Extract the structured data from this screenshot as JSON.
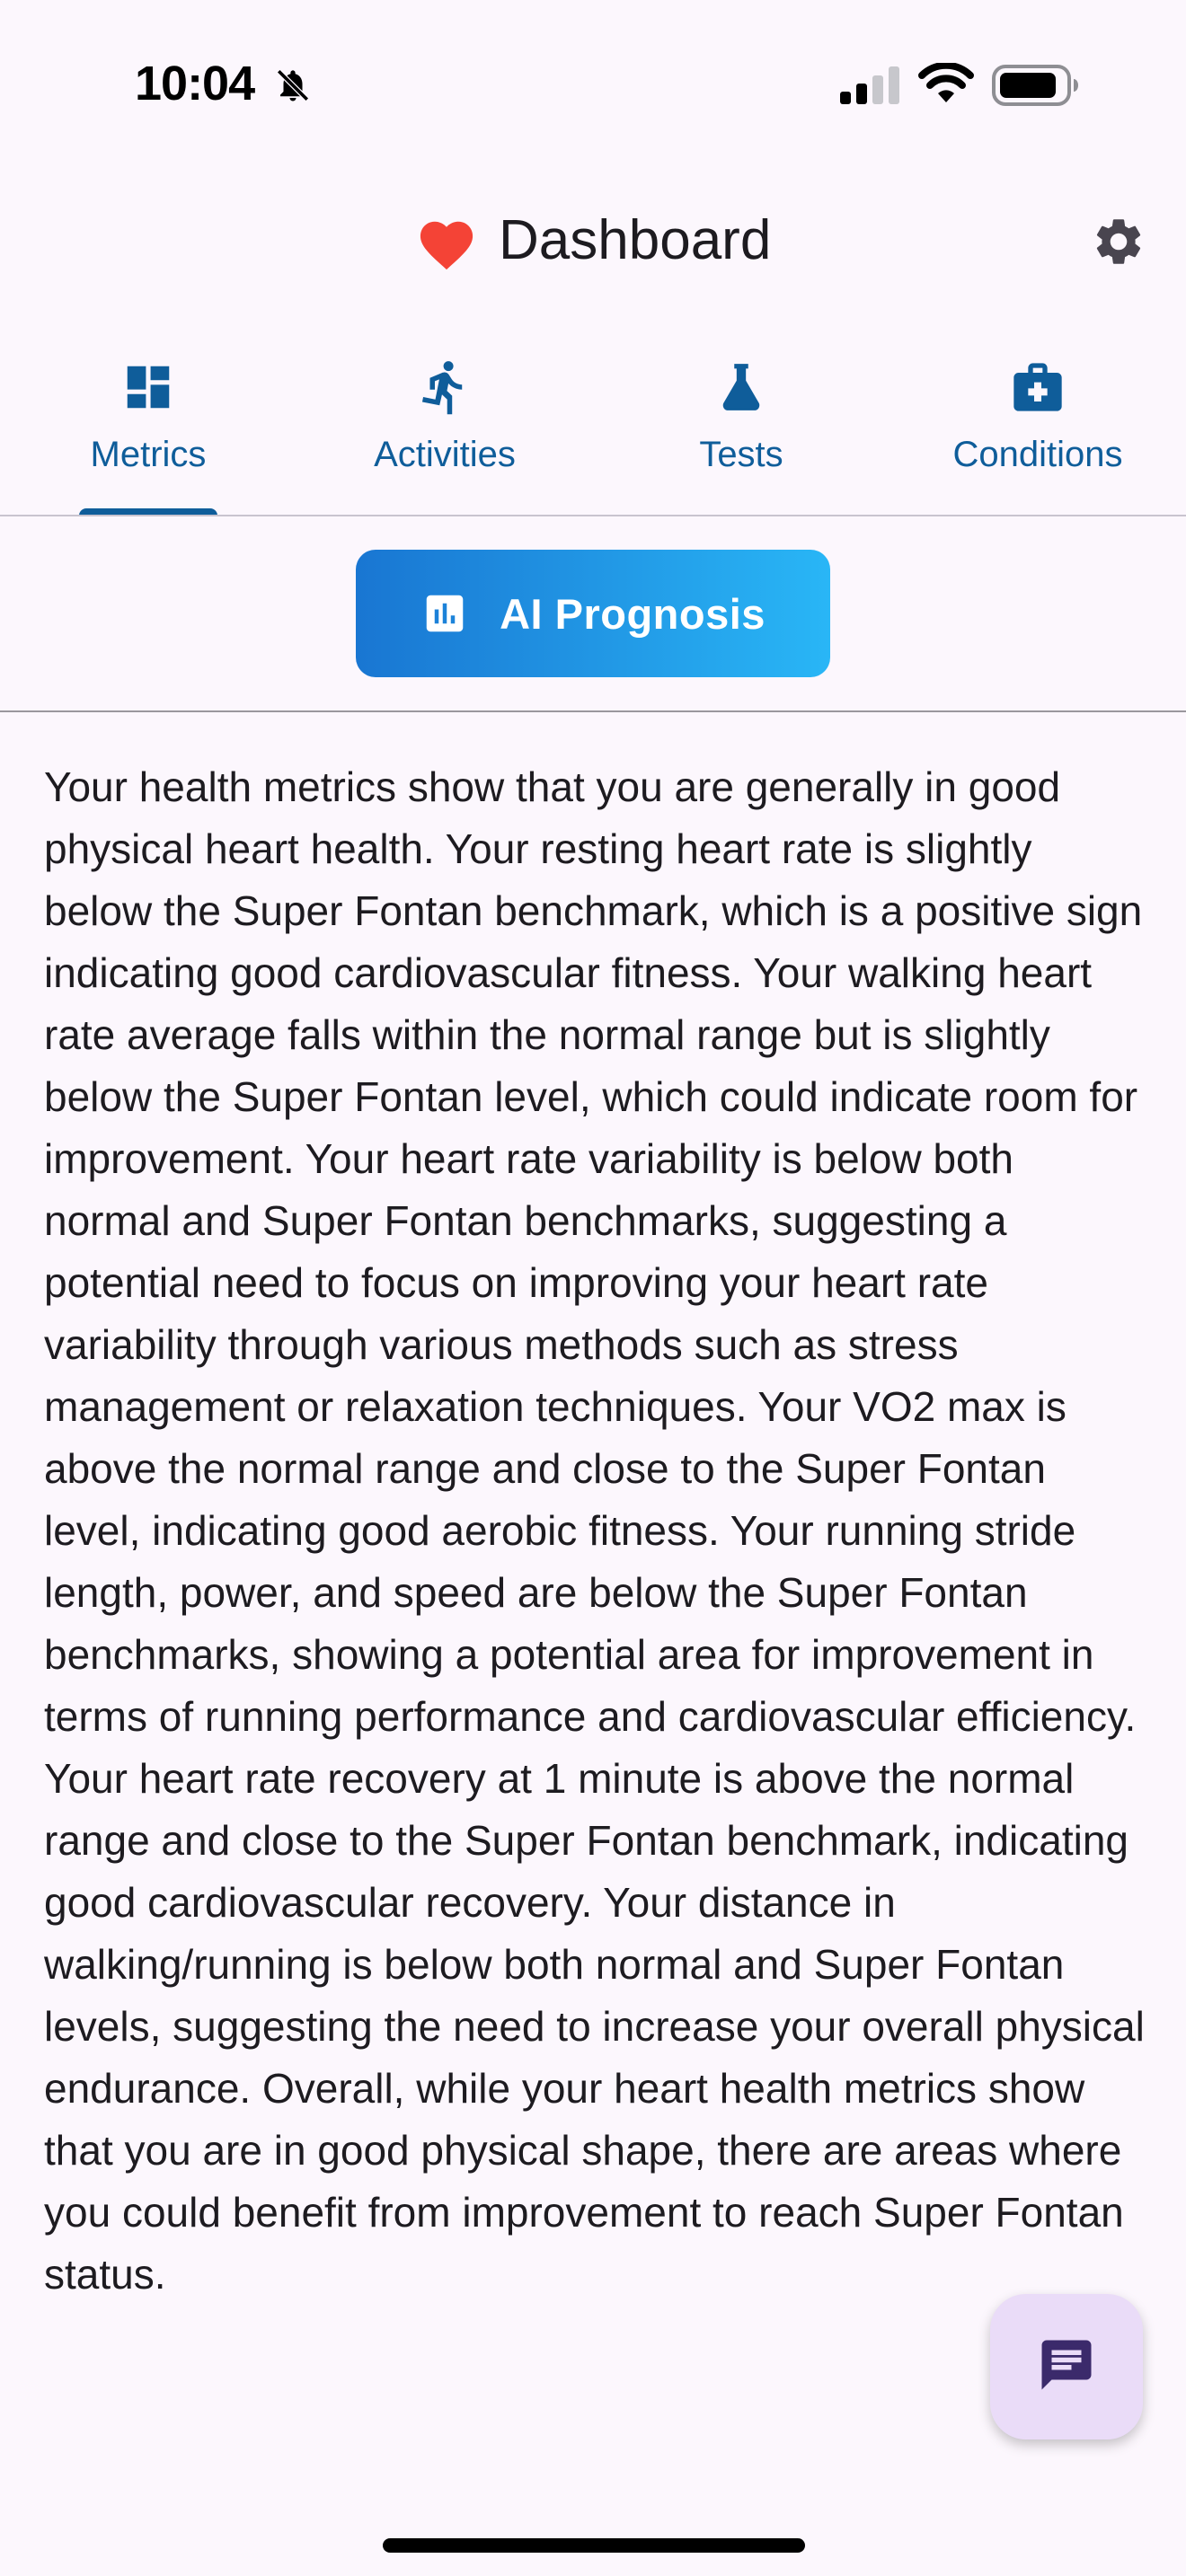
{
  "status_bar": {
    "time": "10:04"
  },
  "header": {
    "title": "Dashboard"
  },
  "tabs": [
    {
      "label": "Metrics",
      "icon": "dashboard-icon",
      "selected": true
    },
    {
      "label": "Activities",
      "icon": "running-icon",
      "selected": false
    },
    {
      "label": "Tests",
      "icon": "flask-icon",
      "selected": false
    },
    {
      "label": "Conditions",
      "icon": "medical-kit-icon",
      "selected": false
    }
  ],
  "ai_button": {
    "label": "AI Prognosis",
    "icon": "bar-chart-icon"
  },
  "prognosis": {
    "text": "Your health metrics show that you are generally in good physical heart health. Your resting heart rate is slightly below the Super Fontan benchmark, which is a positive sign indicating good cardiovascular fitness. Your walking heart rate average falls within the normal range but is slightly below the Super Fontan level, which could indicate room for improvement. Your heart rate variability is below both normal and Super Fontan benchmarks, suggesting a potential need to focus on improving your heart rate variability through various methods such as stress management or relaxation techniques. Your VO2 max is above the normal range and close to the Super Fontan level, indicating good aerobic fitness. Your running stride length, power, and speed are below the Super Fontan benchmarks, showing a potential area for improvement in terms of running performance and cardiovascular efficiency. Your heart rate recovery at 1 minute is above the normal range and close to the Super Fontan benchmark, indicating good cardiovascular recovery. Your distance in walking/running is below both normal and Super Fontan levels, suggesting the need to increase your overall physical endurance. Overall, while your heart health metrics show that you are in good physical shape, there are areas where you could benefit from improvement to reach Super Fontan status."
  },
  "colors": {
    "primary": "#0f5d9a",
    "heart": "#f44336",
    "gradient_start": "#1976d2",
    "gradient_end": "#29b6f6",
    "fab_background": "#eadcf8",
    "background": "#fcf7fd"
  }
}
